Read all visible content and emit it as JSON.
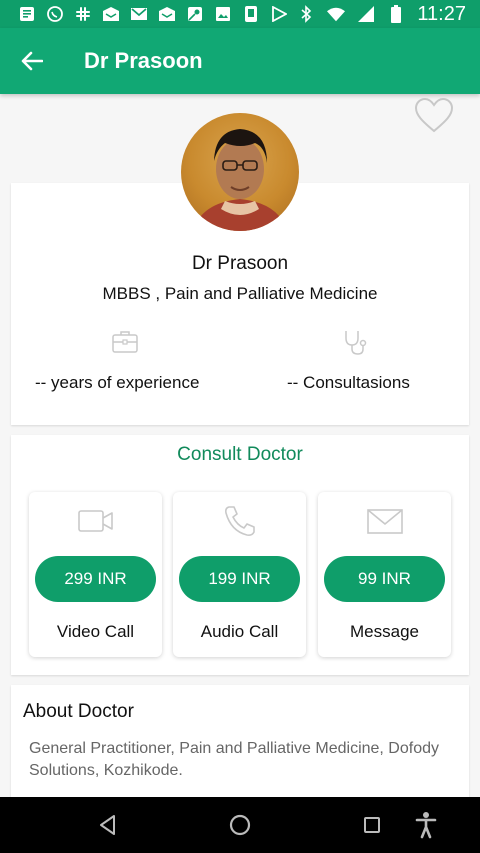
{
  "status_bar": {
    "time": "11:27",
    "left_icons": [
      "news-icon",
      "whatsapp-icon",
      "slack-icon",
      "inbox-icon",
      "gmail-icon",
      "inbox-icon",
      "maps-icon",
      "photos-icon",
      "sim-icon",
      "play-icon"
    ],
    "right_icons": [
      "bluetooth-icon",
      "wifi-icon",
      "signal-icon",
      "battery-icon"
    ]
  },
  "app_bar": {
    "title": "Dr Prasoon"
  },
  "profile": {
    "name": "Dr Prasoon",
    "degree": "MBBS , Pain and Palliative Medicine",
    "experience": "-- years of experience",
    "consultations": "-- Consultasions"
  },
  "consult": {
    "title": "Consult Doctor",
    "options": [
      {
        "price": "299 INR",
        "label": "Video Call",
        "icon": "video-camera-icon"
      },
      {
        "price": "199 INR",
        "label": "Audio Call",
        "icon": "phone-icon"
      },
      {
        "price": "99 INR",
        "label": "Message",
        "icon": "envelope-icon"
      }
    ]
  },
  "about": {
    "title": "About Doctor",
    "text": "General Practitioner, Pain and Palliative Medicine, Dofody Solutions, Kozhikode."
  },
  "colors": {
    "primary": "#11a874",
    "status_bar": "#0f9e6a",
    "accent_text": "#118a5b"
  }
}
